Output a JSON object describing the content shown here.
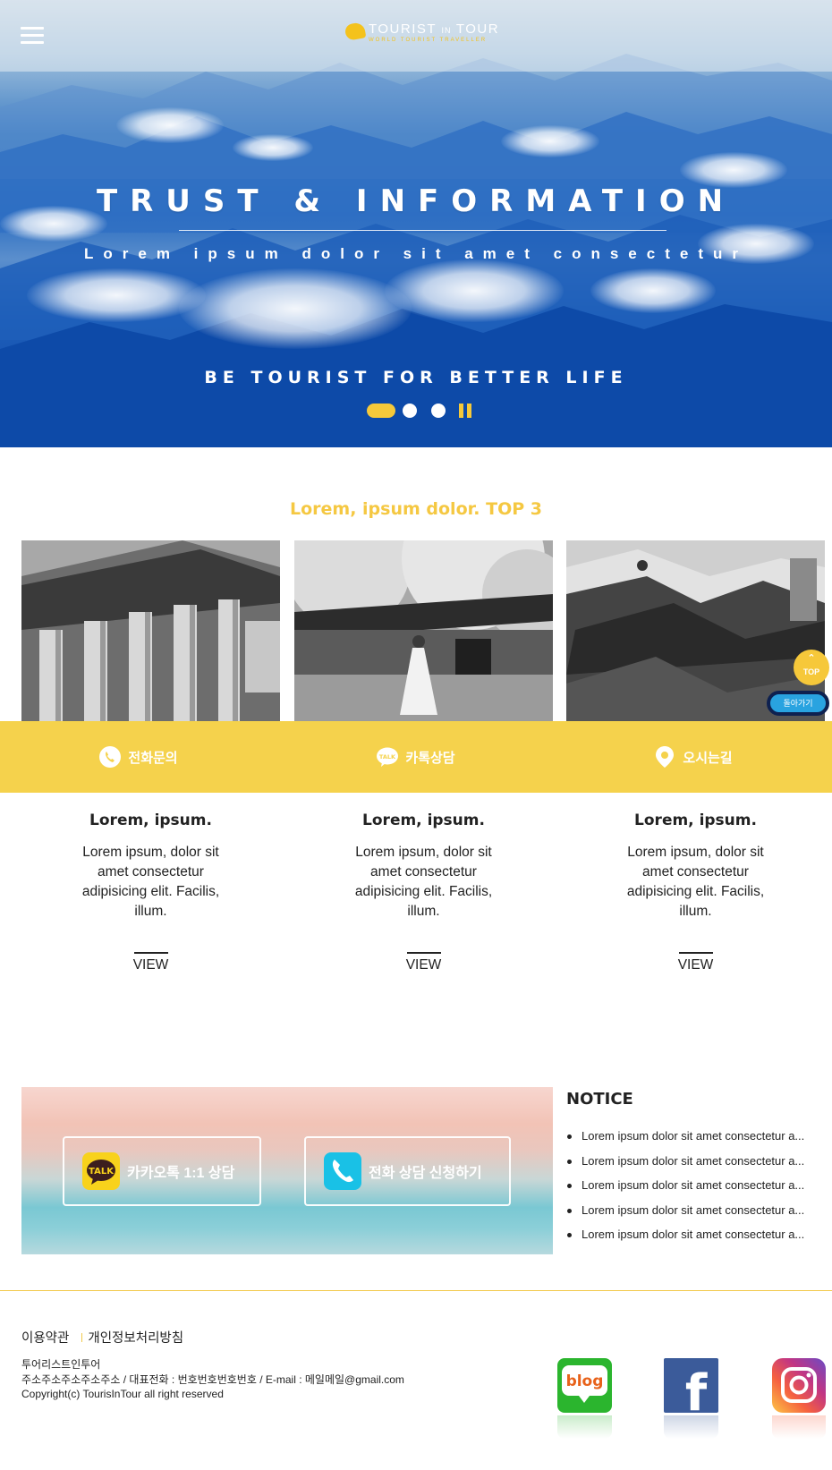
{
  "header": {
    "menu_icon": "hamburger-icon",
    "logo_text_1": "TOURIST",
    "logo_text_small": "IN",
    "logo_text_2": "TOUR",
    "logo_subtitle": "WORLD TOURIST TRAVELLER"
  },
  "hero": {
    "title": "TRUST & INFORMATION",
    "subtitle": "Lorem ipsum dolor sit amet consectetur",
    "tagline": "BE TOURIST FOR BETTER LIFE",
    "slides_count": 3,
    "active_slide": 1,
    "accent_color": "#f5c93a"
  },
  "top3": {
    "title": "Lorem, ipsum dolor. TOP 3",
    "cards": [
      {
        "image": "parthenon-columns-photo",
        "title": "Lorem, ipsum.",
        "text": "Lorem ipsum, dolor sit amet consectetur adipisicing elit. Facilis, illum.",
        "link": "VIEW"
      },
      {
        "image": "korean-palace-cherry-blossom-photo",
        "title": "Lorem, ipsum.",
        "text": "Lorem ipsum, dolor sit amet consectetur adipisicing elit. Facilis, illum.",
        "link": "VIEW"
      },
      {
        "image": "asian-temple-roofs-photo",
        "title": "Lorem, ipsum.",
        "text": "Lorem ipsum, dolor sit amet consectetur adipisicing elit. Facilis, illum.",
        "link": "VIEW"
      }
    ]
  },
  "floating": {
    "top_label": "TOP",
    "back_label": "돌아가기"
  },
  "contact_bar": {
    "color": "#f5d24c",
    "items": [
      {
        "icon": "phone-icon",
        "label": "전화문의"
      },
      {
        "icon": "talk-bubble-icon",
        "label": "카톡상담"
      },
      {
        "icon": "map-pin-icon",
        "label": "오시는길"
      }
    ]
  },
  "consult": {
    "kakao_label": "카카오톡 1:1 상담",
    "kakao_icon_text": "TALK",
    "phone_label": "전화 상담 신청하기"
  },
  "notice": {
    "title": "NOTICE",
    "items": [
      "Lorem ipsum dolor sit amet consectetur a...",
      "Lorem ipsum dolor sit amet consectetur a...",
      "Lorem ipsum dolor sit amet consectetur a...",
      "Lorem ipsum dolor sit amet consectetur a...",
      "Lorem ipsum dolor sit amet consectetur a..."
    ]
  },
  "footer": {
    "terms": "이용약관",
    "privacy": "개인정보처리방침",
    "company": "투어리스트인투어",
    "address_line": "주소주소주소주소주소 / 대표전화 : 번호번호번호번호 / E-mail : 메일메일@gmail.com",
    "copyright": "Copyright(c) TourisInTour all right reserved",
    "sns": [
      {
        "icon": "blog-icon",
        "label": "blog"
      },
      {
        "icon": "facebook-icon",
        "label": "f"
      },
      {
        "icon": "instagram-icon",
        "label": ""
      }
    ]
  }
}
